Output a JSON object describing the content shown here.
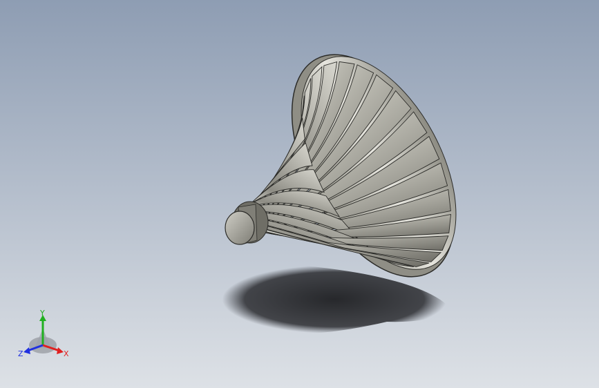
{
  "viewport": {
    "background_top": "#8e9db3",
    "background_bottom": "#dde1e6"
  },
  "model": {
    "icon": "impeller-3d-model",
    "shade_light": "#ecece6",
    "shade_mid": "#a9a89f",
    "shade_dark": "#5f5e58",
    "blade_count": 24
  },
  "triad": {
    "x_label": "X",
    "y_label": "Y",
    "z_label": "Z",
    "x_color": "#e02020",
    "y_color": "#20b020",
    "z_color": "#2030e0"
  }
}
